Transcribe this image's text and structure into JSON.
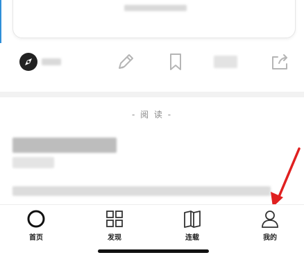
{
  "section": {
    "title": "- 阅 读 -"
  },
  "nav": {
    "items": [
      {
        "label": "首页"
      },
      {
        "label": "发现"
      },
      {
        "label": "连载"
      },
      {
        "label": "我的"
      }
    ]
  },
  "colors": {
    "arrow": "#e02020",
    "accent_line": "#2f8fd8"
  },
  "icons": [
    "compass-icon",
    "pencil-icon",
    "bookmark-icon",
    "share-icon",
    "home-circle-icon",
    "grid-icon",
    "book-icon",
    "user-icon"
  ]
}
